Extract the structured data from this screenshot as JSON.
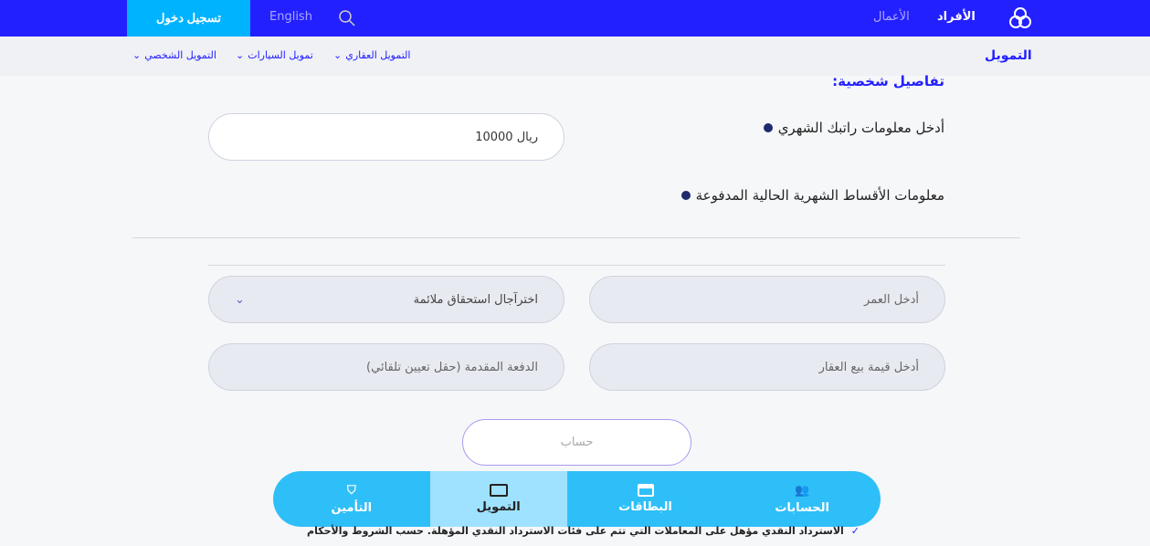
{
  "header": {
    "login": "تسجيل دخول",
    "language": "English",
    "tabs": [
      "الأفراد",
      "الأعمال"
    ]
  },
  "subnav": {
    "title": "التمويل",
    "items": [
      "التمويل العقاري",
      "تمويل السيارات",
      "التمويل الشخصي"
    ]
  },
  "form": {
    "section_title": "تفاصيل شخصية:",
    "salary_label": "أدخل معلومات راتبك الشهري",
    "salary_value": "ريال 10000",
    "installments_label": "معلومات الأقساط الشهرية الحالية المدفوعة",
    "age_placeholder": "أدخل العمر",
    "maturity_select": "اخترآجال استحقاق ملائمة",
    "property_placeholder": "أدخل قيمة بيع العقار",
    "downpayment_placeholder": "الدفعة المقدمة (حقل تعيين تلقائي)",
    "calculate": "حساب"
  },
  "bottom_nav": [
    {
      "label": "الحسابات",
      "icon": "accounts-icon"
    },
    {
      "label": "البطاقات",
      "icon": "card-icon"
    },
    {
      "label": "التمويل",
      "icon": "money-icon",
      "active": true
    },
    {
      "label": "التأمين",
      "icon": "shield-icon"
    }
  ],
  "note": "الاسترداد النقدي مؤهل على المعاملات التي تتم على فئات الاسترداد النقدي المؤهلة. حسب الشروط والأحكام",
  "colors": {
    "primary": "#2320ff",
    "accent": "#00b3ff",
    "nav": "#2fbff8"
  }
}
